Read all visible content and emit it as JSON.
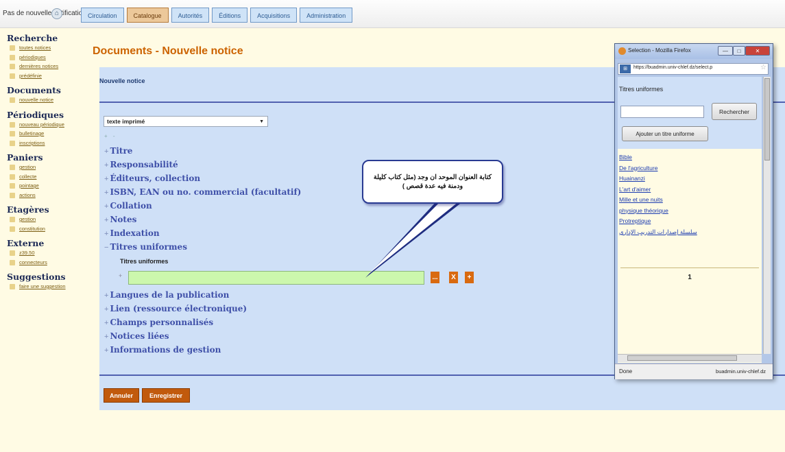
{
  "topbar": {
    "status_message": "Pas de nouvelle notification",
    "tabs": [
      "Circulation",
      "Catalogue",
      "Autorités",
      "Éditions",
      "Acquisitions",
      "Administration"
    ],
    "active_tab": "Catalogue"
  },
  "sidebar": {
    "recherche": {
      "title": "Recherche",
      "links": [
        "toutes notices",
        "périodiques",
        "dernières notices",
        "prédéfinie"
      ]
    },
    "documents": {
      "title": "Documents",
      "links": [
        "nouvelle notice"
      ]
    },
    "periodiques": {
      "title": "Périodiques",
      "links": [
        "nouveau périodique",
        "bulletinage",
        "inscriptions"
      ]
    },
    "paniers": {
      "title": "Paniers",
      "links": [
        "gestion",
        "collecte",
        "pointage",
        "actions"
      ]
    },
    "etageres": {
      "title": "Etagères",
      "links": [
        "gestion",
        "constitution"
      ]
    },
    "externe": {
      "title": "Externe",
      "links": [
        "z39.50",
        "connecteurs"
      ]
    },
    "suggestions": {
      "title": "Suggestions",
      "links": [
        "faire une suggestion"
      ]
    }
  },
  "main": {
    "page_title": "Documents - Nouvelle notice",
    "subtitle": "Nouvelle notice",
    "doc_type_value": "texte imprimé",
    "expand_toggles": "+ -",
    "sections": [
      {
        "sign": "+",
        "label": "Titre"
      },
      {
        "sign": "+",
        "label": "Responsabilité"
      },
      {
        "sign": "+",
        "label": "Éditeurs, collection"
      },
      {
        "sign": "+",
        "label": "ISBN, EAN ou no. commercial (facultatif)"
      },
      {
        "sign": "+",
        "label": "Collation"
      },
      {
        "sign": "+",
        "label": "Notes"
      },
      {
        "sign": "+",
        "label": "Indexation"
      },
      {
        "sign": "−",
        "label": "Titres uniformes"
      }
    ],
    "titres_uniformes_label": "Titres uniformes",
    "field_plus": "+",
    "field_value": "",
    "field_buttons": [
      "...",
      "X",
      "+"
    ],
    "sections_after": [
      {
        "sign": "+",
        "label": "Langues de la publication"
      },
      {
        "sign": "+",
        "label": "Lien (ressource électronique)"
      },
      {
        "sign": "+",
        "label": "Champs personnalisés"
      },
      {
        "sign": "+",
        "label": "Notices liées"
      },
      {
        "sign": "+",
        "label": "Informations de gestion"
      }
    ],
    "cancel_label": "Annuler",
    "save_label": "Enregistrer"
  },
  "callout": {
    "text": "كتابة العنوان الموحد ان وجد (مثل كتاب كليلة ودمنة فيه عدة قصص )"
  },
  "popup": {
    "window_title": "Selection - Mozilla Firefox",
    "url": "https://buadmin.univ-chlef.dz/select.p",
    "heading": "Titres uniformes",
    "search_value": "",
    "search_button": "Rechercher",
    "add_button": "Ajouter un titre uniforme",
    "items": [
      "Bible",
      "De l'agriculture",
      "Huainanzi",
      "L'art d'aimer",
      "Mille et une nuits",
      "physique théorique",
      "Protreptique",
      "سلسلة إصدارات التدريب الإداري"
    ],
    "page_number": "1",
    "status": "Done",
    "status_domain": "buadmin.univ-chlef.dz"
  }
}
